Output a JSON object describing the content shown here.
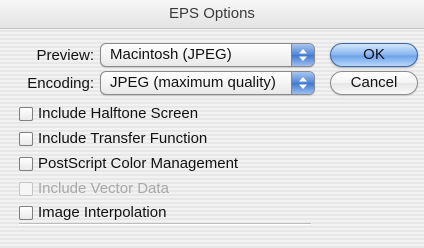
{
  "window": {
    "title": "EPS Options"
  },
  "preview": {
    "label": "Preview:",
    "value": "Macintosh  (JPEG)"
  },
  "encoding": {
    "label": "Encoding:",
    "value": "JPEG  (maximum quality)"
  },
  "buttons": {
    "ok": "OK",
    "cancel": "Cancel"
  },
  "options": [
    {
      "label": "Include Halftone Screen",
      "checked": false,
      "enabled": true
    },
    {
      "label": "Include Transfer Function",
      "checked": false,
      "enabled": true
    },
    {
      "label": "PostScript Color Management",
      "checked": false,
      "enabled": true
    },
    {
      "label": "Include Vector Data",
      "checked": false,
      "enabled": false
    },
    {
      "label": "Image Interpolation",
      "checked": false,
      "enabled": true
    }
  ]
}
